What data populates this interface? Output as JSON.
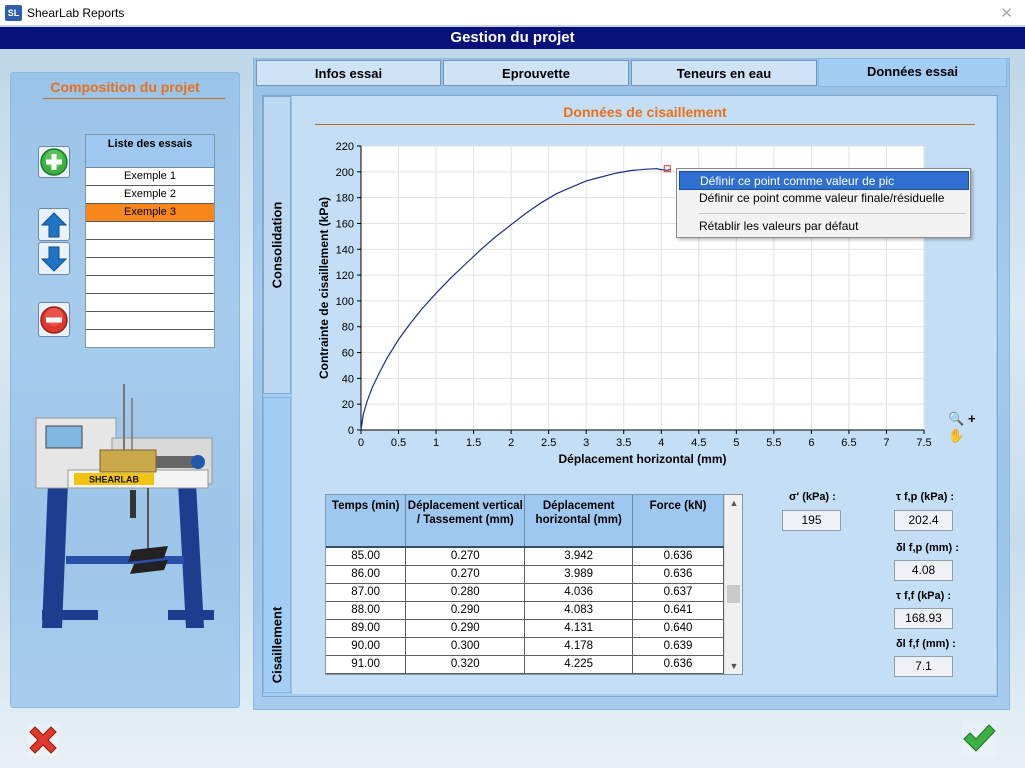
{
  "window": {
    "title": "ShearLab Reports",
    "icon_text": "SL",
    "close_glyph": "✕"
  },
  "header": {
    "title": "Gestion du projet"
  },
  "left_panel": {
    "title": "Composition du projet",
    "list_header": "Liste des essais",
    "items": [
      "Exemple 1",
      "Exemple 2",
      "Exemple 3"
    ],
    "selected_index": 2,
    "machine_brand": "SHEARLAB"
  },
  "tabs": [
    {
      "label": "Infos essai",
      "active": false
    },
    {
      "label": "Eprouvette",
      "active": false
    },
    {
      "label": "Teneurs en eau",
      "active": false
    },
    {
      "label": "Données essai",
      "active": true
    }
  ],
  "vertical_tabs": {
    "consolidation": "Consolidation",
    "cisaillement": "Cisaillement"
  },
  "section_title": "Données de cisaillement",
  "chart_data": {
    "type": "line",
    "xlabel": "Déplacement horizontal (mm)",
    "ylabel": "Contrainte de cisaillement (kPa)",
    "xlim": [
      0,
      7.5
    ],
    "ylim": [
      0,
      220
    ],
    "xticks": [
      "0",
      "0.5",
      "1",
      "1.5",
      "2",
      "2.5",
      "3",
      "3.5",
      "4",
      "4.5",
      "5",
      "5.5",
      "6",
      "6.5",
      "7",
      "7.5"
    ],
    "yticks": [
      "0",
      "20",
      "40",
      "60",
      "80",
      "100",
      "120",
      "140",
      "160",
      "180",
      "200",
      "220"
    ],
    "grid": true,
    "series": [
      {
        "color": "#1b2f8a",
        "x": [
          0,
          0.03,
          0.08,
          0.15,
          0.25,
          0.35,
          0.5,
          0.65,
          0.8,
          1.0,
          1.2,
          1.4,
          1.6,
          1.8,
          2.0,
          2.2,
          2.4,
          2.6,
          2.8,
          3.0,
          3.2,
          3.4,
          3.6,
          3.8,
          3.942,
          3.989,
          4.036,
          4.083,
          4.131
        ],
        "y": [
          0,
          12,
          22,
          33,
          45,
          56,
          70,
          82,
          93,
          106,
          118,
          129,
          140,
          150,
          159,
          168,
          176,
          183,
          188,
          193,
          196,
          199,
          201,
          202,
          202.4,
          201.8,
          201.6,
          201.2,
          202
        ]
      }
    ],
    "marker": {
      "x": 4.08,
      "y": 202.4,
      "color": "#e03030"
    }
  },
  "context_menu": {
    "items": [
      "Définir ce point comme valeur de pic",
      "Définir ce point comme valeur finale/résiduelle",
      "Rétablir les valeurs par défaut"
    ],
    "highlighted_index": 0
  },
  "zoom_icons": {
    "zoom_glyph": "🔍",
    "plus_glyph": "+",
    "pan_glyph": "✋"
  },
  "table": {
    "headers": [
      "Temps (min)",
      "Déplacement vertical / Tassement (mm)",
      "Déplacement horizontal (mm)",
      "Force (kN)"
    ],
    "rows": [
      [
        "85.00",
        "0.270",
        "3.942",
        "0.636"
      ],
      [
        "86.00",
        "0.270",
        "3.989",
        "0.636"
      ],
      [
        "87.00",
        "0.280",
        "4.036",
        "0.637"
      ],
      [
        "88.00",
        "0.290",
        "4.083",
        "0.641"
      ],
      [
        "89.00",
        "0.290",
        "4.131",
        "0.640"
      ],
      [
        "90.00",
        "0.300",
        "4.178",
        "0.639"
      ],
      [
        "91.00",
        "0.320",
        "4.225",
        "0.636"
      ]
    ]
  },
  "fields": {
    "sigma_label": "σ' (kPa) :",
    "sigma_value": "195",
    "tau_fp_label": "τ f,p (kPa) :",
    "tau_fp_value": "202.4",
    "dl_fp_label": "δl f,p (mm) :",
    "dl_fp_value": "4.08",
    "tau_ff_label": "τ f,f (kPa) :",
    "tau_ff_value": "168.93",
    "dl_ff_label": "δl f,f (mm) :",
    "dl_ff_value": "7.1"
  },
  "colors": {
    "accent_orange": "#e8711b",
    "header_navy": "#08107a",
    "selected_row": "#f7861b",
    "menu_highlight": "#2f6fd0"
  }
}
